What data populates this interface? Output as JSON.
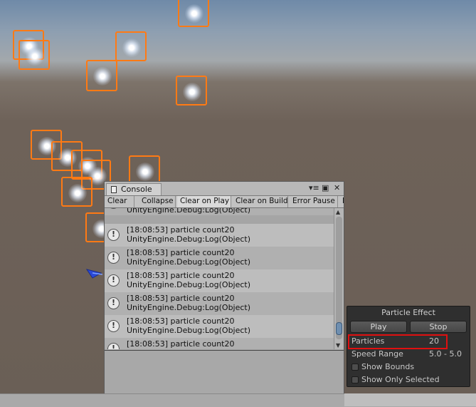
{
  "console": {
    "tab_label": "Console",
    "window_menu_icon": "menu-icon",
    "toolbar": {
      "clear": "Clear",
      "collapse": "Collapse",
      "clear_on_play": "Clear on Play",
      "clear_on_build": "Clear on Build",
      "error_pause": "Error Pause",
      "cut_off": "E"
    },
    "logs": [
      {
        "line1": "[18:08:53] particle count20",
        "line2": "UnityEngine.Debug:Log(Object)"
      },
      {
        "line1": "[18:08:53] particle count20",
        "line2": "UnityEngine.Debug:Log(Object)"
      },
      {
        "line1": "[18:08:53] particle count20",
        "line2": "UnityEngine.Debug:Log(Object)"
      },
      {
        "line1": "[18:08:53] particle count20",
        "line2": "UnityEngine.Debug:Log(Object)"
      },
      {
        "line1": "[18:08:53] particle count20",
        "line2": "UnityEngine.Debug:Log(Object)"
      },
      {
        "line1": "[18:08:53] particle count20",
        "line2": "UnityEngine.Debug:Log(Object)"
      },
      {
        "line1": "[18:08:53] particle count20",
        "line2": ""
      }
    ]
  },
  "particle_effect": {
    "title": "Particle Effect",
    "play": "Play",
    "stop": "Stop",
    "particles_label": "Particles",
    "particles_value": "20",
    "speed_range_label": "Speed Range",
    "speed_range_value": "5.0 - 5.0",
    "show_bounds": "Show Bounds",
    "show_only_selected": "Show Only Selected"
  },
  "colors": {
    "particle_outline": "#ff7a14",
    "highlight_box": "#e01010"
  }
}
